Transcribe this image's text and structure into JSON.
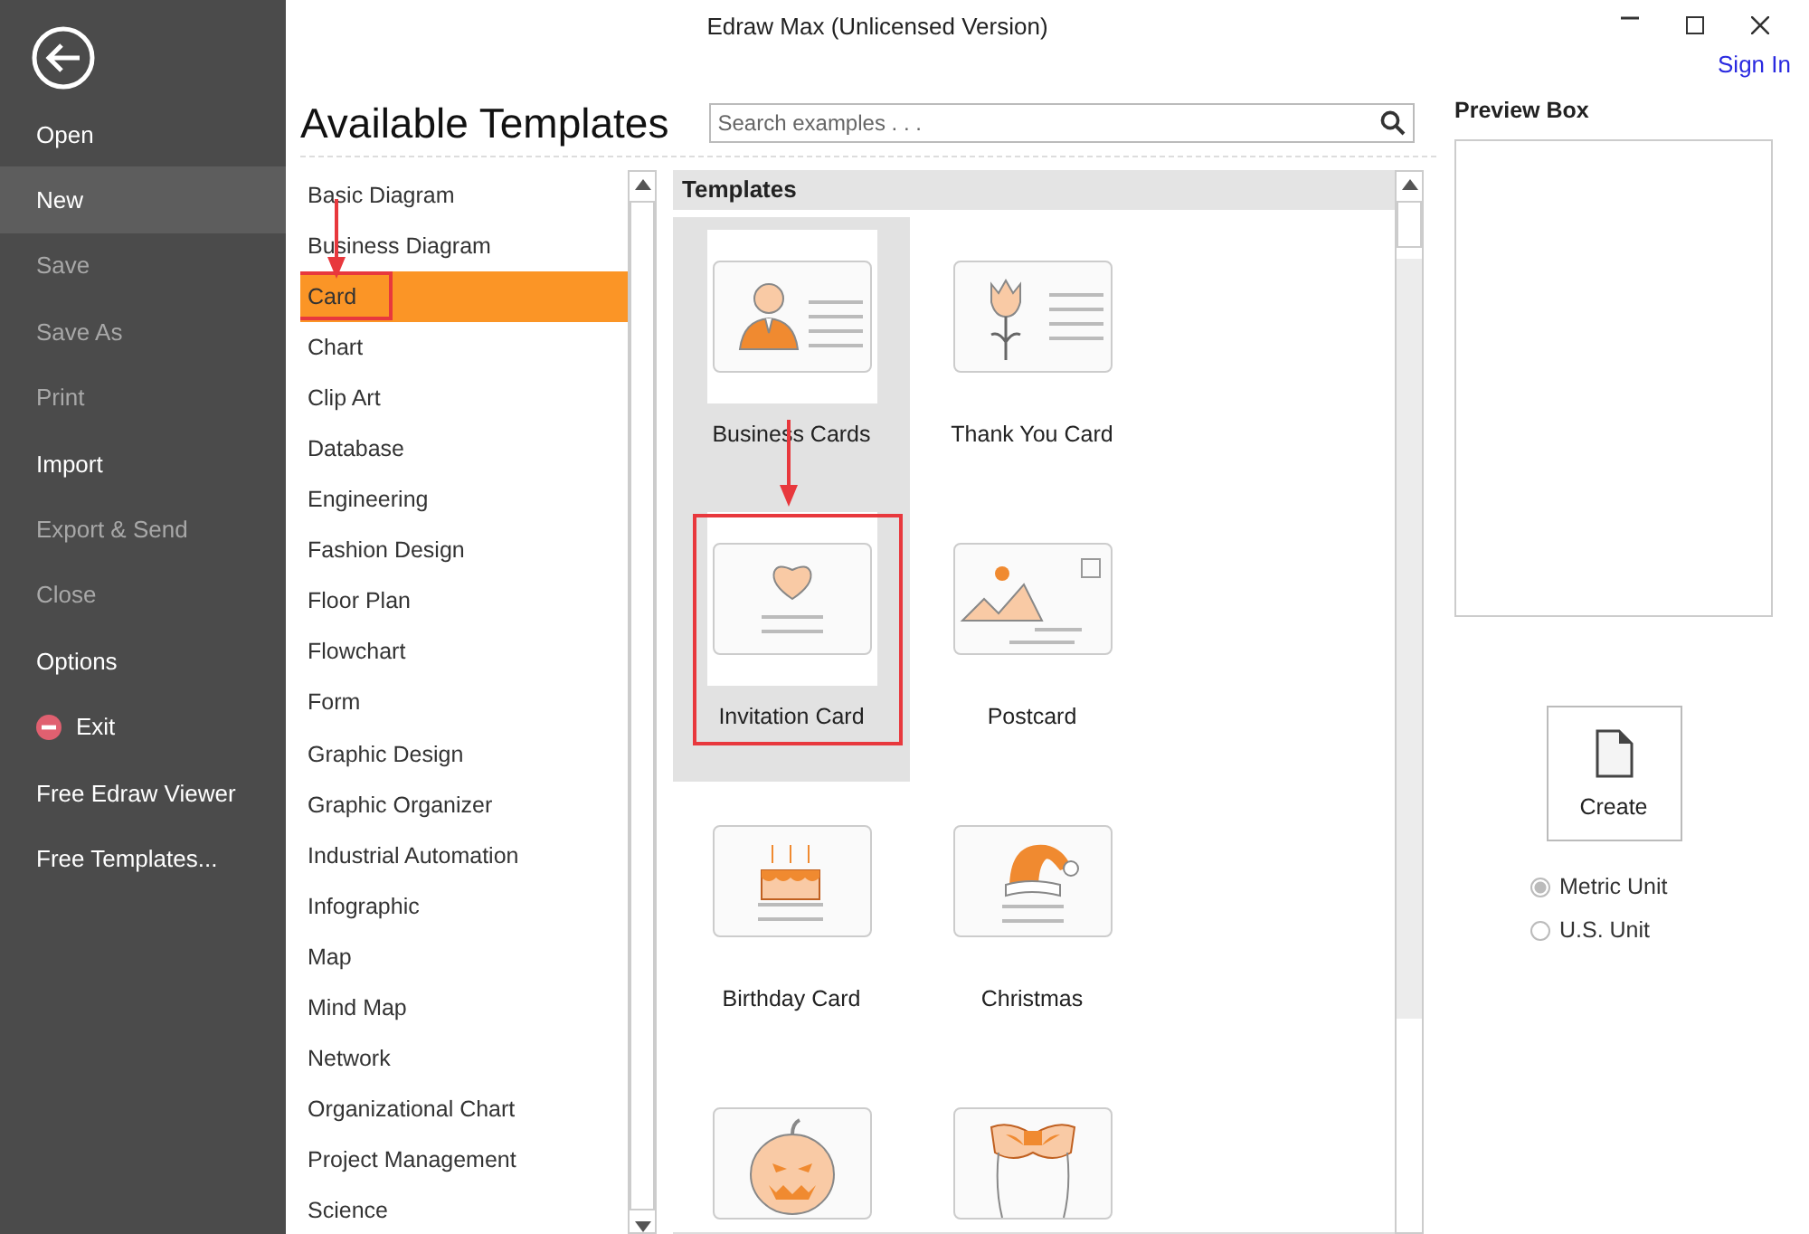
{
  "window": {
    "title": "Edraw Max (Unlicensed Version)",
    "sign_in": "Sign In"
  },
  "sidebar": {
    "items": [
      {
        "label": "Open",
        "kind": "plain",
        "disabled": false,
        "selected": false
      },
      {
        "label": "New",
        "kind": "plain",
        "disabled": false,
        "selected": true
      },
      {
        "label": "Save",
        "kind": "plain",
        "disabled": true,
        "selected": false
      },
      {
        "label": "Save As",
        "kind": "plain",
        "disabled": true,
        "selected": false
      },
      {
        "label": "Print",
        "kind": "plain",
        "disabled": true,
        "selected": false
      },
      {
        "label": "Import",
        "kind": "plain",
        "disabled": false,
        "selected": false
      },
      {
        "label": "Export & Send",
        "kind": "plain",
        "disabled": true,
        "selected": false
      },
      {
        "label": "Close",
        "kind": "plain",
        "disabled": true,
        "selected": false
      },
      {
        "label": "Options",
        "kind": "plain",
        "disabled": false,
        "selected": false
      },
      {
        "label": "Exit",
        "kind": "exit",
        "disabled": false,
        "selected": false
      },
      {
        "label": "Free Edraw Viewer",
        "kind": "plain",
        "disabled": false,
        "selected": false
      },
      {
        "label": "Free Templates...",
        "kind": "plain",
        "disabled": false,
        "selected": false
      }
    ]
  },
  "heading": "Available Templates",
  "search": {
    "placeholder": "Search examples . . ."
  },
  "categories": [
    {
      "label": "Basic Diagram",
      "selected": false,
      "highlighted": false
    },
    {
      "label": "Business Diagram",
      "selected": false,
      "highlighted": false
    },
    {
      "label": "Card",
      "selected": true,
      "highlighted": true
    },
    {
      "label": "Chart",
      "selected": false,
      "highlighted": false
    },
    {
      "label": "Clip Art",
      "selected": false,
      "highlighted": false
    },
    {
      "label": "Database",
      "selected": false,
      "highlighted": false
    },
    {
      "label": "Engineering",
      "selected": false,
      "highlighted": false
    },
    {
      "label": "Fashion Design",
      "selected": false,
      "highlighted": false
    },
    {
      "label": "Floor Plan",
      "selected": false,
      "highlighted": false
    },
    {
      "label": "Flowchart",
      "selected": false,
      "highlighted": false
    },
    {
      "label": "Form",
      "selected": false,
      "highlighted": false
    },
    {
      "label": "Graphic Design",
      "selected": false,
      "highlighted": false
    },
    {
      "label": "Graphic Organizer",
      "selected": false,
      "highlighted": false
    },
    {
      "label": "Industrial Automation",
      "selected": false,
      "highlighted": false
    },
    {
      "label": "Infographic",
      "selected": false,
      "highlighted": false
    },
    {
      "label": "Map",
      "selected": false,
      "highlighted": false
    },
    {
      "label": "Mind Map",
      "selected": false,
      "highlighted": false
    },
    {
      "label": "Network",
      "selected": false,
      "highlighted": false
    },
    {
      "label": "Organizational Chart",
      "selected": false,
      "highlighted": false
    },
    {
      "label": "Project Management",
      "selected": false,
      "highlighted": false
    },
    {
      "label": "Science",
      "selected": false,
      "highlighted": false
    }
  ],
  "templates": {
    "title": "Templates",
    "items": [
      {
        "label": "Business Cards",
        "kind": "person",
        "selected": true,
        "highlighted": false
      },
      {
        "label": "Thank You Card",
        "kind": "tulip",
        "selected": false,
        "highlighted": false
      },
      {
        "label": "Invitation Card",
        "kind": "heart",
        "selected": true,
        "highlighted": true
      },
      {
        "label": "Postcard",
        "kind": "landscape",
        "selected": false,
        "highlighted": false
      },
      {
        "label": "Birthday Card",
        "kind": "cake",
        "selected": false,
        "highlighted": false
      },
      {
        "label": "Christmas",
        "kind": "hat",
        "selected": false,
        "highlighted": false
      },
      {
        "kind": "pumpkin",
        "selected": false,
        "highlighted": false
      },
      {
        "kind": "mask",
        "selected": false,
        "highlighted": false
      }
    ]
  },
  "preview": {
    "title": "Preview Box"
  },
  "create_button": "Create",
  "units": [
    {
      "label": "Metric Unit",
      "selected": true
    },
    {
      "label": "U.S. Unit",
      "selected": false
    }
  ]
}
